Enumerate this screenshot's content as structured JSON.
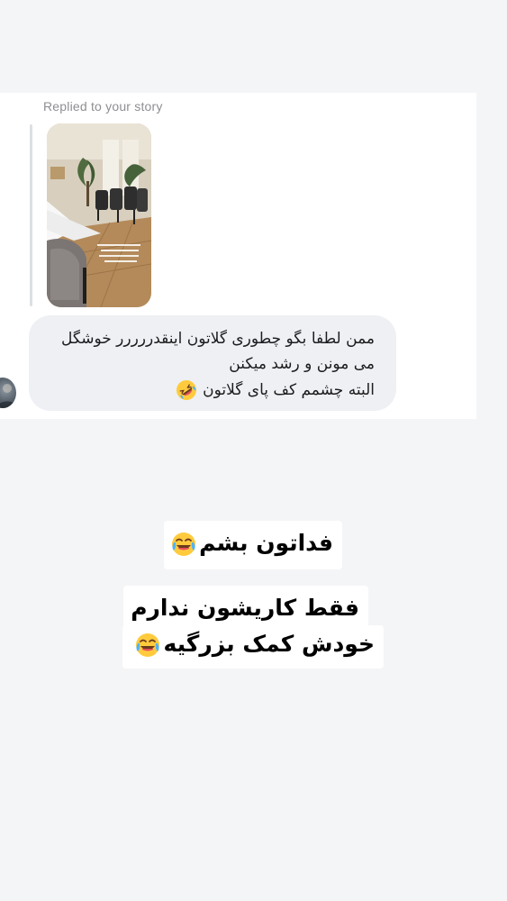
{
  "dm": {
    "replied_label": "Replied to your story",
    "story_thumbnail": {
      "icon": "story-photo-thumbnail"
    },
    "message": {
      "line1": "ممن لطفا بگو چطوری گلاتون اینقدررررر خوشگل",
      "line2": "می مونن و رشد میکنن",
      "line3": "البته چشمم کف پای گلاتون",
      "emoji": "rolling-on-floor-laughing-icon"
    },
    "sender_avatar": {
      "icon": "avatar"
    }
  },
  "stickers": {
    "sticker1": {
      "text": "فداتون بشم",
      "emoji": "face-with-tears-of-joy-icon"
    },
    "sticker2": {
      "line1": "فقط کاریشون ندارم",
      "line2": "خودش کمک بزرگیه",
      "emoji": "face-with-tears-of-joy-icon"
    }
  },
  "colors": {
    "background": "#f4f5f7",
    "card": "#ffffff",
    "bubble": "#eef0f3",
    "label": "#8e8e93",
    "text": "#1c1c1e"
  }
}
